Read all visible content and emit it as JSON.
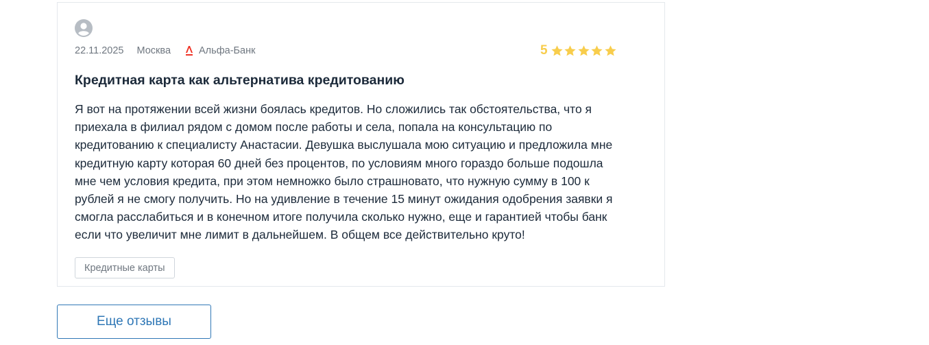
{
  "review": {
    "date": "22.11.2025",
    "city": "Москва",
    "bank": "Альфа-Банк",
    "rating": "5",
    "stars": 5,
    "title": "Кредитная карта как альтернатива кредитованию",
    "text_lines": [
      "Я вот на протяжении всей жизни боялась кредитов. Но сложились так обстоятельства, что я",
      "приехала в филиал рядом с домом после работы и села, попала на консультацию по",
      "кредитованию к специалисту Анастасии. Девушка выслушала мою ситуацию и предложила мне",
      "кредитную карту которая 60 дней без процентов, по условиям много гораздо больше подошла",
      "мне чем условия кредита, при этом немножко было страшновато, что нужную сумму в 100 к",
      "рублей я не смогу получить. Но на удивление в течение 15 минут ожидания одобрения заявки я",
      "смогла расслабиться и в конечном итоге получила сколько нужно, еще и гарантией чтобы банк",
      "если что увеличит мне лимит в дальнейшем. В общем все действительно круто!"
    ],
    "tag": "Кредитные карты"
  },
  "more_button_label": "Еще отзывы",
  "colors": {
    "star": "#f8cd4c",
    "accent": "#2f77b6",
    "bank_logo": "#ef3124",
    "avatar": "#b7bdc4"
  },
  "icons": {
    "avatar": "user-avatar-icon",
    "bank": "alfa-bank-logo-icon",
    "star": "star-icon"
  }
}
